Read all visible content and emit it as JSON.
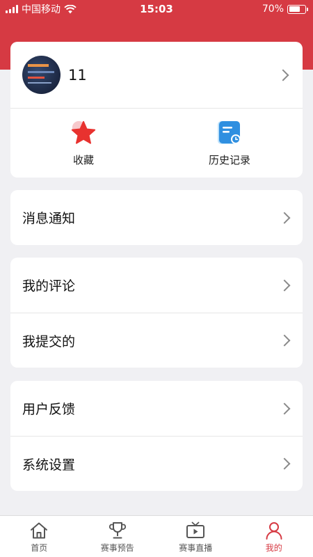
{
  "status_bar": {
    "carrier": "中国移动",
    "time": "15:03",
    "battery": "70%",
    "battery_level": 0.7
  },
  "profile": {
    "username": "11"
  },
  "quick_actions": [
    {
      "label": "收藏",
      "icon": "star-icon"
    },
    {
      "label": "历史记录",
      "icon": "history-icon"
    }
  ],
  "menu_groups": [
    [
      "消息通知"
    ],
    [
      "我的评论",
      "我提交的"
    ],
    [
      "用户反馈",
      "系统设置"
    ]
  ],
  "tabbar": [
    {
      "label": "首页",
      "icon": "home-icon"
    },
    {
      "label": "赛事预告",
      "icon": "trophy-icon"
    },
    {
      "label": "赛事直播",
      "icon": "tv-icon"
    },
    {
      "label": "我的",
      "icon": "person-icon",
      "active": true
    }
  ],
  "colors": {
    "brand_red": "#d63a43",
    "history_blue": "#2f8fe0",
    "background": "#f0f0f3"
  }
}
